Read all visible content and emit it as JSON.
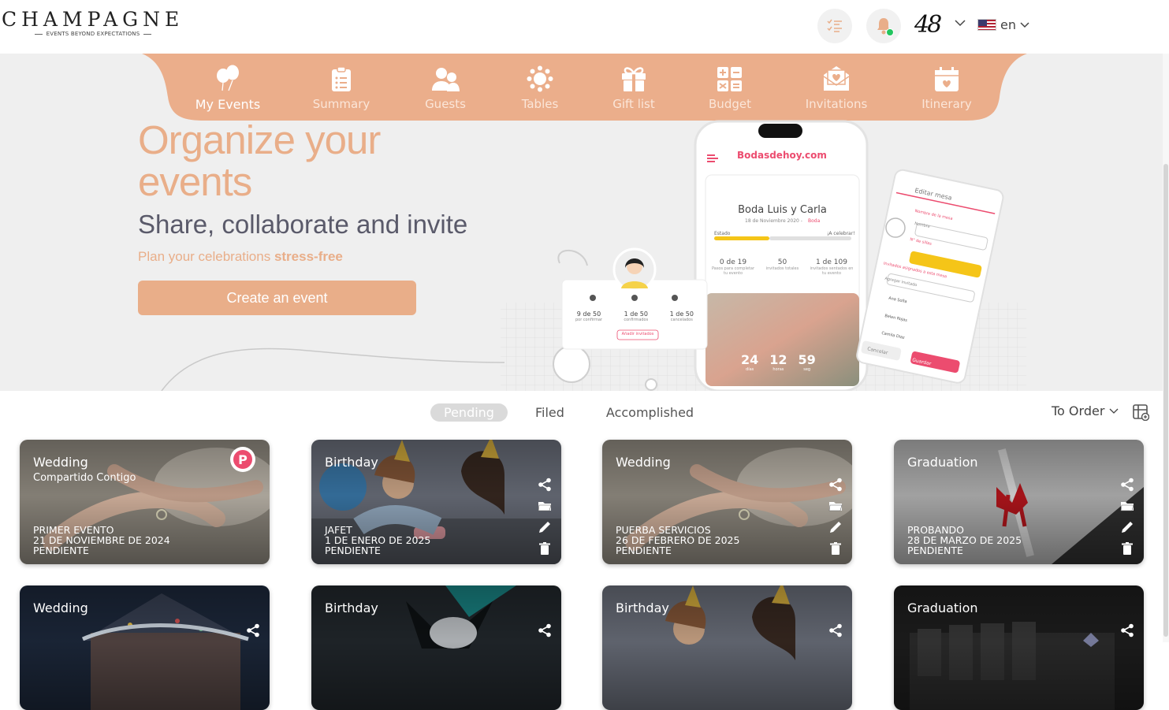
{
  "brand": {
    "name": "CHAMPAGNE",
    "tagline": "EVENTS BEYOND EXPECTATIONS"
  },
  "header": {
    "user_initials": "48",
    "language": "en"
  },
  "nav": {
    "items": [
      {
        "label": "My Events",
        "icon": "balloons-icon",
        "active": true
      },
      {
        "label": "Summary",
        "icon": "clipboard-icon"
      },
      {
        "label": "Guests",
        "icon": "guests-icon"
      },
      {
        "label": "Tables",
        "icon": "tables-icon"
      },
      {
        "label": "Gift list",
        "icon": "gift-icon"
      },
      {
        "label": "Budget",
        "icon": "calculator-icon"
      },
      {
        "label": "Invitations",
        "icon": "envelope-heart-icon"
      },
      {
        "label": "Itinerary",
        "icon": "calendar-heart-icon"
      }
    ]
  },
  "hero": {
    "title": "Organize your events",
    "subtitle": "Share, collaborate and invite",
    "tagline_prefix": "Plan your celebrations ",
    "tagline_bold": "stress-free",
    "cta": "Create an event"
  },
  "mockup": {
    "app_brand": "Bodasdehoy.com",
    "event_title": "Boda Luis y Carla",
    "event_date": "18 de Noviembre 2020 -",
    "event_type": "Boda",
    "status_label": "Estado",
    "status_msg": "¡A celebrar!",
    "stats": [
      {
        "value": "0 de 19",
        "label": "Pasos para completar tu evento"
      },
      {
        "value": "50",
        "label": "invitados totales"
      },
      {
        "value": "1 de 109",
        "label": "invitados sentados en tu evento"
      }
    ],
    "countdown": [
      {
        "value": "24",
        "unit": "días"
      },
      {
        "value": "12",
        "unit": "horas"
      },
      {
        "value": "59",
        "unit": "seg"
      }
    ],
    "guest_stats": [
      {
        "value": "9 de 50",
        "label": "por confirmar"
      },
      {
        "value": "1 de 50",
        "label": "confirmados"
      },
      {
        "value": "1 de 50",
        "label": "cancelados"
      }
    ],
    "add_guests": "Añadir invitados",
    "edit_table": {
      "title": "Editar mesa",
      "name_label": "Nombre de la mesa",
      "name_placeholder": "Nombre",
      "seats_label": "N° de sillas",
      "assigned_label": "Invitados asignados a esta mesa",
      "add_guest": "Agregar invitado",
      "guests": [
        "Ana Sofia",
        "Belen Rojas",
        "Camila Diaz"
      ],
      "cancel": "Cancelar",
      "save": "Guardar"
    }
  },
  "filters": {
    "tabs": [
      {
        "label": "Pending",
        "active": true
      },
      {
        "label": "Filed"
      },
      {
        "label": "Accomplished"
      }
    ],
    "order_label": "To Order"
  },
  "cards": [
    {
      "type": "Wedding",
      "shared": "Compartido Contigo",
      "name": "PRIMER EVENTO",
      "date": "21 DE NOVIEMBRE DE 2024",
      "status": "PENDIENTE",
      "image": "wedding-rings"
    },
    {
      "type": "Birthday",
      "shared": "",
      "name": "JAFET",
      "date": "1 DE ENERO DE 2025",
      "status": "PENDIENTE",
      "image": "birthday-party"
    },
    {
      "type": "Wedding",
      "shared": "",
      "name": "PUERBA SERVICIOS",
      "date": "26 DE FEBRERO DE 2025",
      "status": "PENDIENTE",
      "image": "wedding-rings"
    },
    {
      "type": "Graduation",
      "shared": "",
      "name": "PROBANDO",
      "date": "28 DE MARZO DE 2025",
      "status": "PENDIENTE",
      "image": "graduation-diploma"
    },
    {
      "type": "Wedding",
      "shared": "",
      "name": "",
      "date": "",
      "status": "",
      "image": "winter-house"
    },
    {
      "type": "Birthday",
      "shared": "",
      "name": "",
      "date": "",
      "status": "",
      "image": "dark-fantasy"
    },
    {
      "type": "Birthday",
      "shared": "",
      "name": "",
      "date": "",
      "status": "",
      "image": "birthday-party"
    },
    {
      "type": "Graduation",
      "shared": "",
      "name": "",
      "date": "",
      "status": "",
      "image": "graduation-text"
    }
  ],
  "colors": {
    "accent": "#e9ae89",
    "nav": "#ebae8b",
    "hero_bg": "#efefef",
    "pink": "#ec4c6f"
  }
}
